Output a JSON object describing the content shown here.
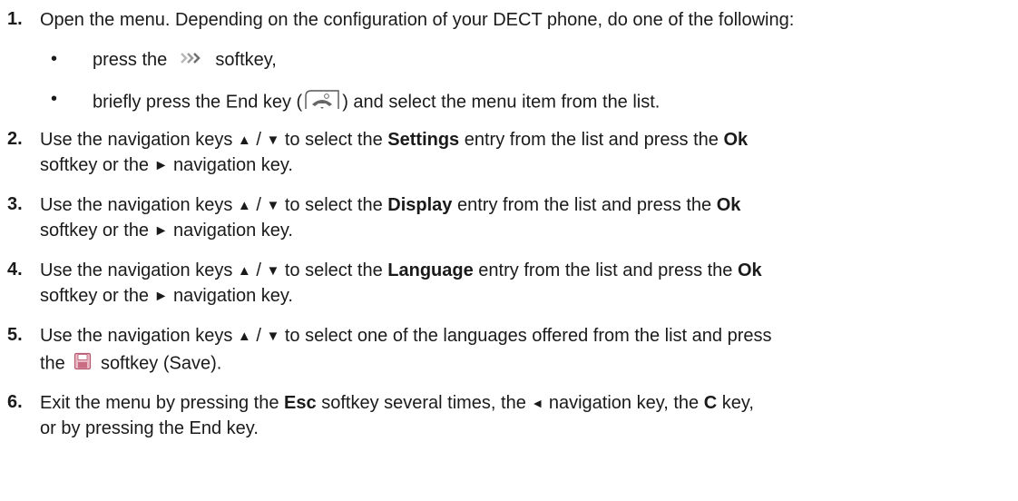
{
  "steps": [
    {
      "number": "1.",
      "lines": [
        [
          "Open the menu. Depending on the configuration of your DECT phone, do one of the following:"
        ]
      ],
      "bullets": [
        {
          "before": "press the",
          "after": "softkey,"
        },
        {
          "before": "briefly press the End key (",
          "after": ") and select the menu item from the list."
        }
      ]
    },
    {
      "number": "2.",
      "line1": {
        "a": "Use the navigation keys",
        "sep": "/",
        "b": "to select the",
        "bold": "Settings",
        "c": "entry from the list and press the",
        "ok": "Ok"
      },
      "line2": {
        "a": "softkey or the",
        "b": "navigation key."
      }
    },
    {
      "number": "3.",
      "line1": {
        "a": "Use the navigation keys",
        "sep": "/",
        "b": "to select the",
        "bold": "Display",
        "c": "entry from the list and press the",
        "ok": "Ok"
      },
      "line2": {
        "a": "softkey or the",
        "b": "navigation key."
      }
    },
    {
      "number": "4.",
      "line1": {
        "a": "Use the navigation keys",
        "sep": "/",
        "b": "to select the",
        "bold": "Language",
        "c": "entry from the list and press the",
        "ok": "Ok"
      },
      "line2": {
        "a": "softkey or the",
        "b": "navigation key."
      }
    },
    {
      "number": "5.",
      "line1": {
        "a": "Use the navigation keys",
        "sep": "/",
        "b": "to select one of the languages offered from the list and press"
      },
      "line2": {
        "a": "the",
        "b": "softkey (Save)."
      }
    },
    {
      "number": "6.",
      "line1": {
        "a": "Exit the menu by pressing the",
        "esc": "Esc",
        "b": "softkey several times, the",
        "c": "navigation key, the",
        "ckey": "C",
        "d": "key,"
      },
      "line2": {
        "a": "or by pressing the End key."
      }
    }
  ],
  "bullet_char": "•",
  "icons": {
    "up": "▲",
    "down": "▼",
    "right": "►",
    "left": "◄",
    "more": "more-softkey-icon",
    "end": "end-key-icon",
    "save": "save-icon"
  }
}
